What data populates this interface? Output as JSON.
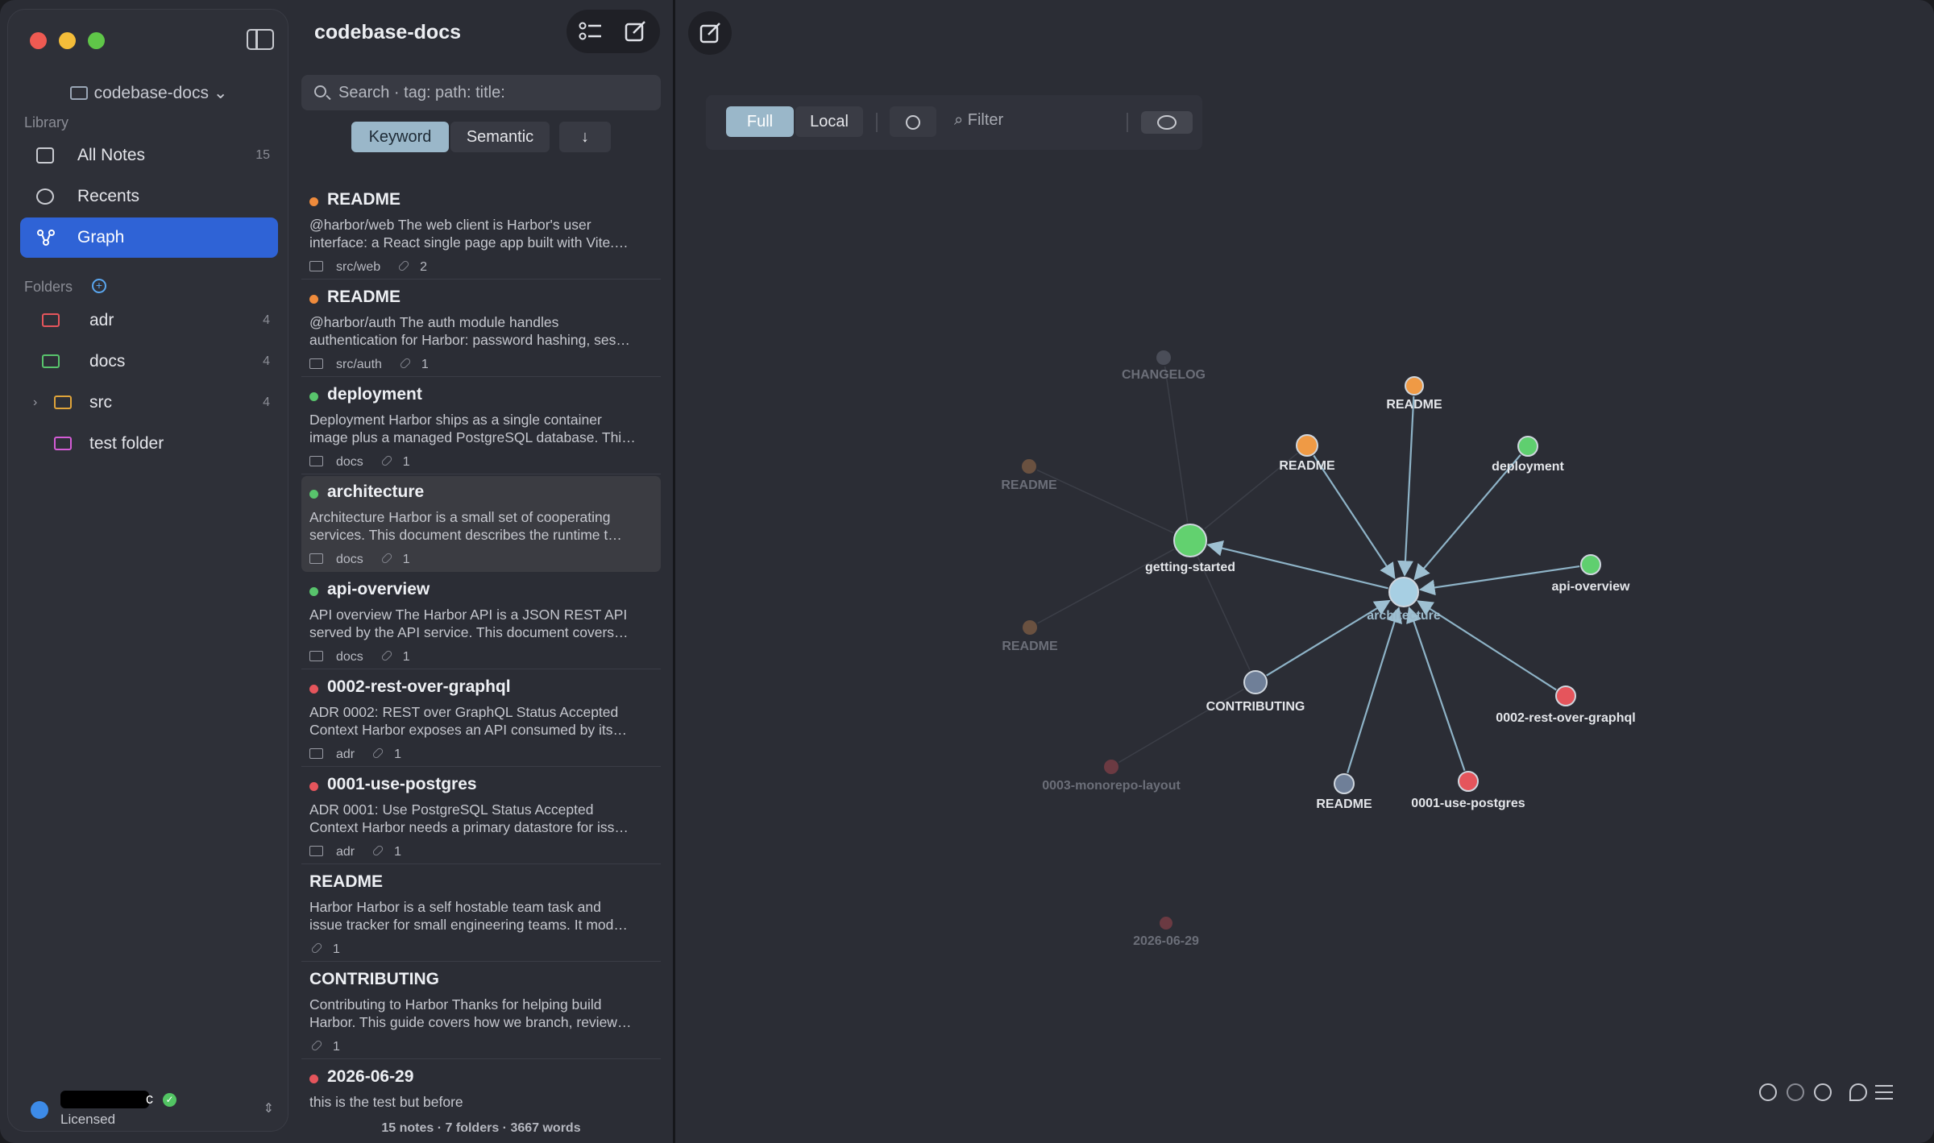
{
  "sidebar": {
    "vault_name": "codebase-docs",
    "library_label": "Library",
    "nav": [
      {
        "label": "All Notes",
        "count": "15"
      },
      {
        "label": "Recents",
        "count": ""
      },
      {
        "label": "Graph",
        "count": ""
      }
    ],
    "folders_label": "Folders",
    "folders": [
      {
        "label": "adr",
        "count": "4",
        "color": "#e5555c"
      },
      {
        "label": "docs",
        "count": "4",
        "color": "#58c46c"
      },
      {
        "label": "src",
        "count": "4",
        "color": "#e0a43a"
      },
      {
        "label": "test folder",
        "count": "",
        "color": "#d45cd6"
      }
    ],
    "user": {
      "name_suffix": "c",
      "license": "Licensed"
    }
  },
  "list": {
    "title": "codebase-docs",
    "search_placeholder": "Search · tag: path: title:",
    "modes": [
      "Keyword",
      "Semantic"
    ],
    "sort_icon": "↓",
    "notes": [
      {
        "title": "README",
        "line1": "@harbor/web The web client is Harbor's user",
        "line2": "interface: a React single page app built with Vite.…",
        "folder": "src/web",
        "links": "2",
        "dot": "#ef8b3c"
      },
      {
        "title": "README",
        "line1": "@harbor/auth The auth module handles",
        "line2": "authentication for Harbor: password hashing, ses…",
        "folder": "src/auth",
        "links": "1",
        "dot": "#ef8b3c"
      },
      {
        "title": "deployment",
        "line1": "Deployment Harbor ships as a single container",
        "line2": "image plus a managed PostgreSQL database. Thi…",
        "folder": "docs",
        "links": "1",
        "dot": "#58c46c"
      },
      {
        "title": "architecture",
        "line1": "Architecture Harbor is a small set of cooperating",
        "line2": "services. This document describes the runtime t…",
        "folder": "docs",
        "links": "1",
        "dot": "#58c46c"
      },
      {
        "title": "api-overview",
        "line1": "API overview The Harbor API is a JSON REST API",
        "line2": "served by the API service. This document covers…",
        "folder": "docs",
        "links": "1",
        "dot": "#58c46c"
      },
      {
        "title": "0002-rest-over-graphql",
        "line1": "ADR 0002: REST over GraphQL Status Accepted",
        "line2": "Context Harbor exposes an API consumed by its…",
        "folder": "adr",
        "links": "1",
        "dot": "#e5555c"
      },
      {
        "title": "0001-use-postgres",
        "line1": "ADR 0001: Use PostgreSQL Status Accepted",
        "line2": "Context Harbor needs a primary datastore for iss…",
        "folder": "adr",
        "links": "1",
        "dot": "#e5555c"
      },
      {
        "title": "README",
        "line1": "Harbor Harbor is a self hostable team task and",
        "line2": "issue tracker for small engineering teams. It mod…",
        "folder": "",
        "links": "1",
        "dot": ""
      },
      {
        "title": "CONTRIBUTING",
        "line1": "Contributing to Harbor Thanks for helping build",
        "line2": "Harbor. This guide covers how we branch, review…",
        "folder": "",
        "links": "1",
        "dot": ""
      },
      {
        "title": "2026-06-29",
        "line1": "this is the test but before",
        "line2": "",
        "folder": "",
        "links": "",
        "dot": "#e5555c"
      }
    ],
    "footer": {
      "notes": "15 notes",
      "folders": "7 folders",
      "words": "3667 words"
    }
  },
  "graph": {
    "modes": [
      "Full",
      "Local"
    ],
    "filter_placeholder": "Filter",
    "nodes": [
      {
        "id": "architecture",
        "label": "architecture",
        "color": "#a7cfe3",
        "dim": false
      },
      {
        "id": "getting-started",
        "label": "getting-started",
        "color": "#62d16f",
        "dim": false
      },
      {
        "id": "readme-top",
        "label": "README",
        "color": "#ef9a45",
        "dim": false
      },
      {
        "id": "readme-mid",
        "label": "README",
        "color": "#ef9a45",
        "dim": false
      },
      {
        "id": "deployment",
        "label": "deployment",
        "color": "#5fcf6f",
        "dim": false
      },
      {
        "id": "api-overview",
        "label": "api-overview",
        "color": "#5fcf6f",
        "dim": false
      },
      {
        "id": "0002",
        "label": "0002-rest-over-graphql",
        "color": "#e5555c",
        "dim": false
      },
      {
        "id": "0001",
        "label": "0001-use-postgres",
        "color": "#e5555c",
        "dim": false
      },
      {
        "id": "readme-bottom",
        "label": "README",
        "color": "#6f7f98",
        "dim": false
      },
      {
        "id": "contributing",
        "label": "CONTRIBUTING",
        "color": "#6f7f98",
        "dim": false
      },
      {
        "id": "changelog",
        "label": "CHANGELOG",
        "color": "#4a4d58",
        "dim": true
      },
      {
        "id": "readme-left1",
        "label": "README",
        "color": "#6a5140",
        "dim": true
      },
      {
        "id": "readme-left2",
        "label": "README",
        "color": "#6a5140",
        "dim": true
      },
      {
        "id": "0003",
        "label": "0003-monorepo-layout",
        "color": "#6b3a42",
        "dim": true
      },
      {
        "id": "2026",
        "label": "2026-06-29",
        "color": "#6b3a42",
        "dim": true
      }
    ]
  },
  "colors": {
    "accent": "#2f63d6",
    "segment_active": "#9ab7c9",
    "bg": "#2b2d35"
  }
}
